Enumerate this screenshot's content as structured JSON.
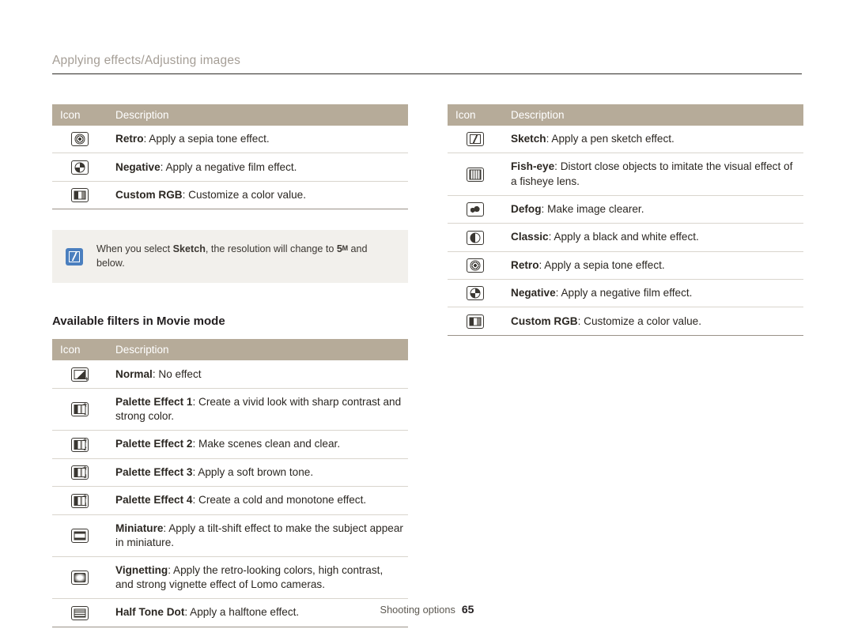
{
  "header": {
    "title": "Applying effects/Adjusting images"
  },
  "left_column": {
    "table1": {
      "headers": {
        "icon": "Icon",
        "description": "Description"
      },
      "rows": [
        {
          "icon": "retro-icon",
          "name": "Retro",
          "text": ": Apply a sepia tone effect."
        },
        {
          "icon": "negative-icon",
          "name": "Negative",
          "text": ": Apply a negative film effect."
        },
        {
          "icon": "custom-rgb-icon",
          "name": "Custom RGB",
          "text": ": Customize a color value."
        }
      ]
    },
    "note": {
      "icon": "note-icon",
      "text_before": "When you select ",
      "bold_word": "Sketch",
      "text_middle": ", the resolution will change to ",
      "resolution": "5",
      "resolution_unit": "M",
      "text_after": " and below."
    },
    "section_heading": "Available filters in Movie mode",
    "table2": {
      "headers": {
        "icon": "Icon",
        "description": "Description"
      },
      "rows": [
        {
          "icon": "normal-icon",
          "name": "Normal",
          "text": ": No effect"
        },
        {
          "icon": "palette-effect-1-icon",
          "name": "Palette Effect 1",
          "text": ": Create a vivid look with sharp contrast and strong color."
        },
        {
          "icon": "palette-effect-2-icon",
          "name": "Palette Effect 2",
          "text": ": Make scenes clean and clear."
        },
        {
          "icon": "palette-effect-3-icon",
          "name": "Palette Effect 3",
          "text": ": Apply a soft brown tone."
        },
        {
          "icon": "palette-effect-4-icon",
          "name": "Palette Effect 4",
          "text": ": Create a cold and monotone effect."
        },
        {
          "icon": "miniature-icon",
          "name": "Miniature",
          "text": ": Apply a tilt-shift effect to make the subject appear in miniature."
        },
        {
          "icon": "vignetting-icon",
          "name": "Vignetting",
          "text": ": Apply the retro-looking colors, high contrast, and strong vignette effect of Lomo cameras."
        },
        {
          "icon": "half-tone-dot-icon",
          "name": "Half Tone Dot",
          "text": ": Apply a halftone effect."
        }
      ]
    }
  },
  "right_column": {
    "table1": {
      "headers": {
        "icon": "Icon",
        "description": "Description"
      },
      "rows": [
        {
          "icon": "sketch-icon",
          "name": "Sketch",
          "text": ": Apply a pen sketch effect."
        },
        {
          "icon": "fish-eye-icon",
          "name": "Fish-eye",
          "text": ": Distort close objects to imitate the visual effect of a fisheye lens."
        },
        {
          "icon": "defog-icon",
          "name": "Defog",
          "text": ": Make image clearer."
        },
        {
          "icon": "classic-icon",
          "name": "Classic",
          "text": ": Apply a black and white effect."
        },
        {
          "icon": "retro-icon",
          "name": "Retro",
          "text": ": Apply a sepia tone effect."
        },
        {
          "icon": "negative-icon",
          "name": "Negative",
          "text": ": Apply a negative film effect."
        },
        {
          "icon": "custom-rgb-icon",
          "name": "Custom RGB",
          "text": ": Customize a color value."
        }
      ]
    }
  },
  "footer": {
    "label": "Shooting options",
    "page_number": "65"
  },
  "colors": {
    "header_band": "#b6ab99",
    "header_text": "#a59e96",
    "note_bg": "#f2f0ec",
    "note_icon": "#4b7fbf",
    "rule": "#2d2a26"
  }
}
